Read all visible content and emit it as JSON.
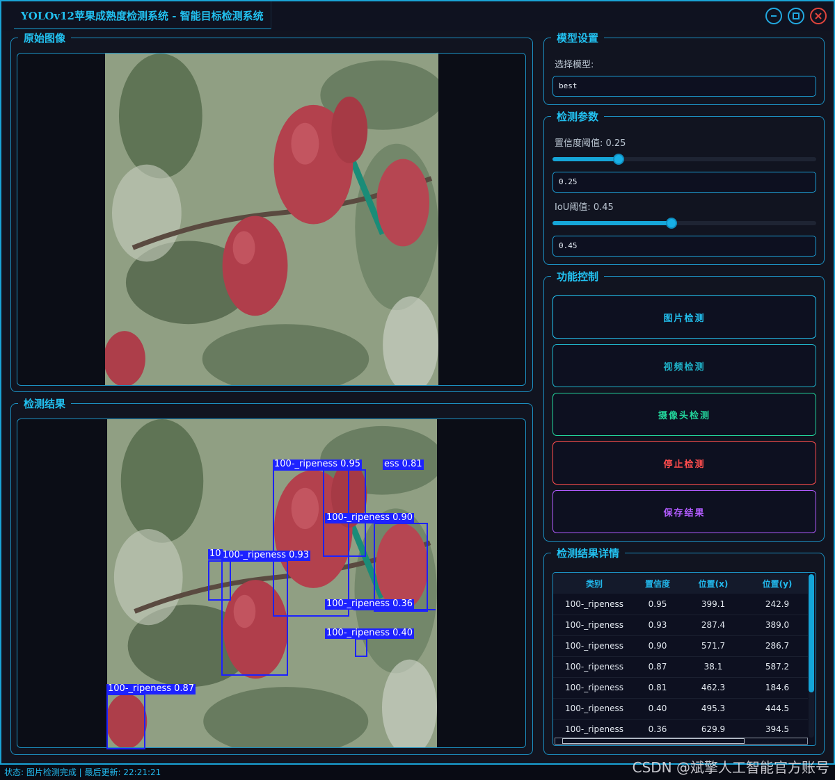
{
  "window": {
    "title": "YOLOv12苹果成熟度检测系统 - 智能目标检测系统"
  },
  "panels": {
    "original": {
      "title": "原始图像"
    },
    "result": {
      "title": "检测结果"
    }
  },
  "model_settings": {
    "title": "模型设置",
    "select_label": "选择模型:",
    "model_value": "best"
  },
  "detect_params": {
    "title": "检测参数",
    "confidence_label": "置信度阈值: 0.25",
    "confidence_value": "0.25",
    "confidence_fraction": 0.25,
    "iou_label": "IoU阈值: 0.45",
    "iou_value": "0.45",
    "iou_fraction": 0.45
  },
  "controls": {
    "title": "功能控制",
    "image_detect": "图片检测",
    "video_detect": "视频检测",
    "camera_detect": "摄像头检测",
    "stop_detect": "停止检测",
    "save_results": "保存结果"
  },
  "colors": {
    "accent": "#22c1f0",
    "image_btn": "#22c1f0",
    "video_btn": "#1fb2c8",
    "camera_btn": "#22d39a",
    "stop_btn": "#ff4d4d",
    "save_btn": "#b25cff",
    "bbox": "#1d22ff"
  },
  "details": {
    "title": "检测结果详情",
    "columns": [
      "类别",
      "置信度",
      "位置(x)",
      "位置(y)"
    ],
    "rows": [
      [
        "100-_ripeness",
        "0.95",
        "399.1",
        "242.9"
      ],
      [
        "100-_ripeness",
        "0.93",
        "287.4",
        "389.0"
      ],
      [
        "100-_ripeness",
        "0.90",
        "571.7",
        "286.7"
      ],
      [
        "100-_ripeness",
        "0.87",
        "38.1",
        "587.2"
      ],
      [
        "100-_ripeness",
        "0.81",
        "462.3",
        "184.6"
      ],
      [
        "100-_ripeness",
        "0.40",
        "495.3",
        "444.5"
      ],
      [
        "100-_ripeness",
        "0.36",
        "629.9",
        "394.5"
      ]
    ]
  },
  "detections": [
    {
      "label": "100-_ripeness 0.95"
    },
    {
      "label": "ess 0.81"
    },
    {
      "label": "100-_ripeness 0.90"
    },
    {
      "label": "100-_ripeness 0.93"
    },
    {
      "label": "10"
    },
    {
      "label": "100-_ripeness 0.36"
    },
    {
      "label": "100-_ripeness 0.40"
    },
    {
      "label": "100-_ripeness 0.87"
    }
  ],
  "status": {
    "text": "状态: 图片检测完成 | 最后更新: 22:21:21"
  },
  "watermark": "CSDN @斌擎人工智能官方账号"
}
